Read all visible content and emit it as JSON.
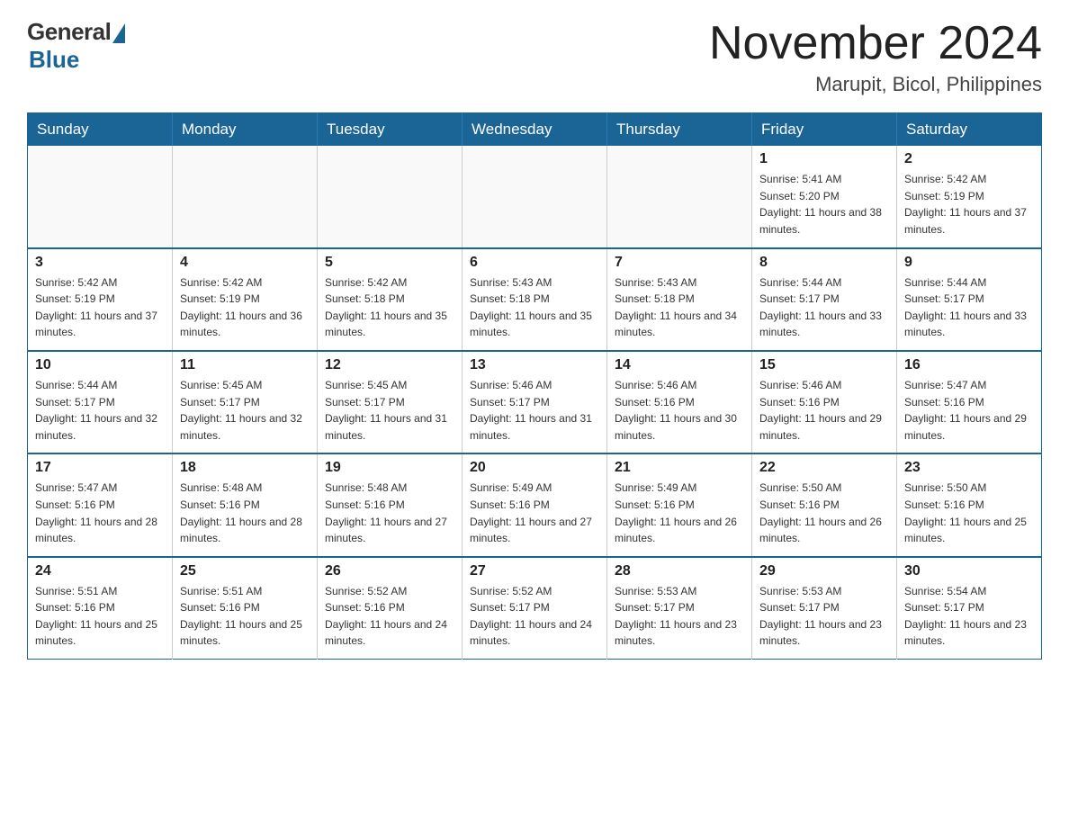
{
  "logo": {
    "general": "General",
    "blue": "Blue"
  },
  "header": {
    "month": "November 2024",
    "location": "Marupit, Bicol, Philippines"
  },
  "weekdays": [
    "Sunday",
    "Monday",
    "Tuesday",
    "Wednesday",
    "Thursday",
    "Friday",
    "Saturday"
  ],
  "weeks": [
    [
      {
        "day": "",
        "info": ""
      },
      {
        "day": "",
        "info": ""
      },
      {
        "day": "",
        "info": ""
      },
      {
        "day": "",
        "info": ""
      },
      {
        "day": "",
        "info": ""
      },
      {
        "day": "1",
        "info": "Sunrise: 5:41 AM\nSunset: 5:20 PM\nDaylight: 11 hours and 38 minutes."
      },
      {
        "day": "2",
        "info": "Sunrise: 5:42 AM\nSunset: 5:19 PM\nDaylight: 11 hours and 37 minutes."
      }
    ],
    [
      {
        "day": "3",
        "info": "Sunrise: 5:42 AM\nSunset: 5:19 PM\nDaylight: 11 hours and 37 minutes."
      },
      {
        "day": "4",
        "info": "Sunrise: 5:42 AM\nSunset: 5:19 PM\nDaylight: 11 hours and 36 minutes."
      },
      {
        "day": "5",
        "info": "Sunrise: 5:42 AM\nSunset: 5:18 PM\nDaylight: 11 hours and 35 minutes."
      },
      {
        "day": "6",
        "info": "Sunrise: 5:43 AM\nSunset: 5:18 PM\nDaylight: 11 hours and 35 minutes."
      },
      {
        "day": "7",
        "info": "Sunrise: 5:43 AM\nSunset: 5:18 PM\nDaylight: 11 hours and 34 minutes."
      },
      {
        "day": "8",
        "info": "Sunrise: 5:44 AM\nSunset: 5:17 PM\nDaylight: 11 hours and 33 minutes."
      },
      {
        "day": "9",
        "info": "Sunrise: 5:44 AM\nSunset: 5:17 PM\nDaylight: 11 hours and 33 minutes."
      }
    ],
    [
      {
        "day": "10",
        "info": "Sunrise: 5:44 AM\nSunset: 5:17 PM\nDaylight: 11 hours and 32 minutes."
      },
      {
        "day": "11",
        "info": "Sunrise: 5:45 AM\nSunset: 5:17 PM\nDaylight: 11 hours and 32 minutes."
      },
      {
        "day": "12",
        "info": "Sunrise: 5:45 AM\nSunset: 5:17 PM\nDaylight: 11 hours and 31 minutes."
      },
      {
        "day": "13",
        "info": "Sunrise: 5:46 AM\nSunset: 5:17 PM\nDaylight: 11 hours and 31 minutes."
      },
      {
        "day": "14",
        "info": "Sunrise: 5:46 AM\nSunset: 5:16 PM\nDaylight: 11 hours and 30 minutes."
      },
      {
        "day": "15",
        "info": "Sunrise: 5:46 AM\nSunset: 5:16 PM\nDaylight: 11 hours and 29 minutes."
      },
      {
        "day": "16",
        "info": "Sunrise: 5:47 AM\nSunset: 5:16 PM\nDaylight: 11 hours and 29 minutes."
      }
    ],
    [
      {
        "day": "17",
        "info": "Sunrise: 5:47 AM\nSunset: 5:16 PM\nDaylight: 11 hours and 28 minutes."
      },
      {
        "day": "18",
        "info": "Sunrise: 5:48 AM\nSunset: 5:16 PM\nDaylight: 11 hours and 28 minutes."
      },
      {
        "day": "19",
        "info": "Sunrise: 5:48 AM\nSunset: 5:16 PM\nDaylight: 11 hours and 27 minutes."
      },
      {
        "day": "20",
        "info": "Sunrise: 5:49 AM\nSunset: 5:16 PM\nDaylight: 11 hours and 27 minutes."
      },
      {
        "day": "21",
        "info": "Sunrise: 5:49 AM\nSunset: 5:16 PM\nDaylight: 11 hours and 26 minutes."
      },
      {
        "day": "22",
        "info": "Sunrise: 5:50 AM\nSunset: 5:16 PM\nDaylight: 11 hours and 26 minutes."
      },
      {
        "day": "23",
        "info": "Sunrise: 5:50 AM\nSunset: 5:16 PM\nDaylight: 11 hours and 25 minutes."
      }
    ],
    [
      {
        "day": "24",
        "info": "Sunrise: 5:51 AM\nSunset: 5:16 PM\nDaylight: 11 hours and 25 minutes."
      },
      {
        "day": "25",
        "info": "Sunrise: 5:51 AM\nSunset: 5:16 PM\nDaylight: 11 hours and 25 minutes."
      },
      {
        "day": "26",
        "info": "Sunrise: 5:52 AM\nSunset: 5:16 PM\nDaylight: 11 hours and 24 minutes."
      },
      {
        "day": "27",
        "info": "Sunrise: 5:52 AM\nSunset: 5:17 PM\nDaylight: 11 hours and 24 minutes."
      },
      {
        "day": "28",
        "info": "Sunrise: 5:53 AM\nSunset: 5:17 PM\nDaylight: 11 hours and 23 minutes."
      },
      {
        "day": "29",
        "info": "Sunrise: 5:53 AM\nSunset: 5:17 PM\nDaylight: 11 hours and 23 minutes."
      },
      {
        "day": "30",
        "info": "Sunrise: 5:54 AM\nSunset: 5:17 PM\nDaylight: 11 hours and 23 minutes."
      }
    ]
  ]
}
